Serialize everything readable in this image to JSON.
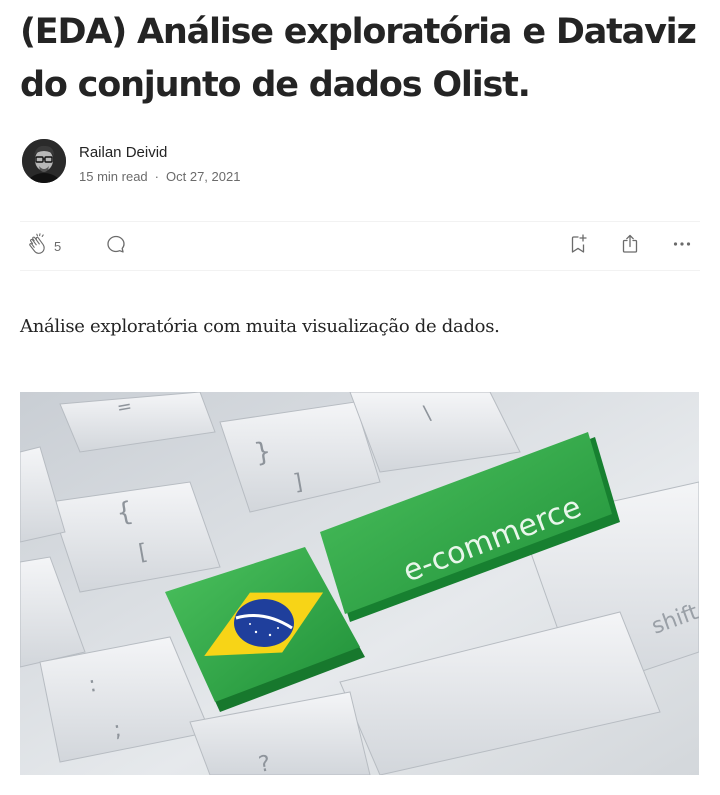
{
  "article": {
    "title": "(EDA) Análise exploratória e Dataviz do conjunto de dados Olist.",
    "subtitle": "Análise exploratória com muita visualização de dados."
  },
  "author": {
    "name": "Railan Deivid",
    "read_time": "15 min read",
    "separator": "·",
    "date": "Oct 27, 2021"
  },
  "actions": {
    "clap_count": "5",
    "icons": [
      "clap-icon",
      "comment-icon",
      "bookmark-icon",
      "share-icon",
      "more-icon"
    ]
  },
  "hero_image": {
    "green_key_text": "e-commerce",
    "shift_key_text": "shift",
    "colors": {
      "key_green": "#2fa84a",
      "flag_yellow": "#f7d417",
      "flag_blue": "#1f3f9c"
    }
  }
}
